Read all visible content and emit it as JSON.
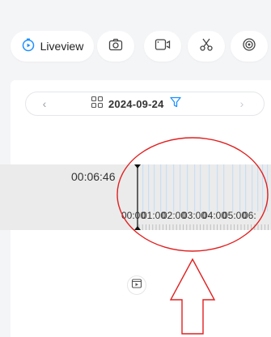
{
  "toolbar": {
    "liveview_label": "Liveview",
    "buttons": [
      {
        "name": "snapshot",
        "icon": "camera-icon"
      },
      {
        "name": "record",
        "icon": "video-camera-icon"
      },
      {
        "name": "clip",
        "icon": "scissors-icon"
      },
      {
        "name": "settings",
        "icon": "aperture-icon"
      }
    ]
  },
  "date_picker": {
    "prev": "‹",
    "next": "›",
    "date": "2024-09-24"
  },
  "timeline": {
    "current_time": "00:06:46",
    "ticks": [
      "00:00",
      "01:00",
      "02:00",
      "03:00",
      "04:00",
      "05:00",
      "06:"
    ],
    "cursor_position_hours": 0.0
  },
  "colors": {
    "accent": "#1e90ff",
    "annotation_red": "#e02020",
    "timeline_bg": "#ebebeb",
    "recording_stripe": "#c9dff4"
  }
}
